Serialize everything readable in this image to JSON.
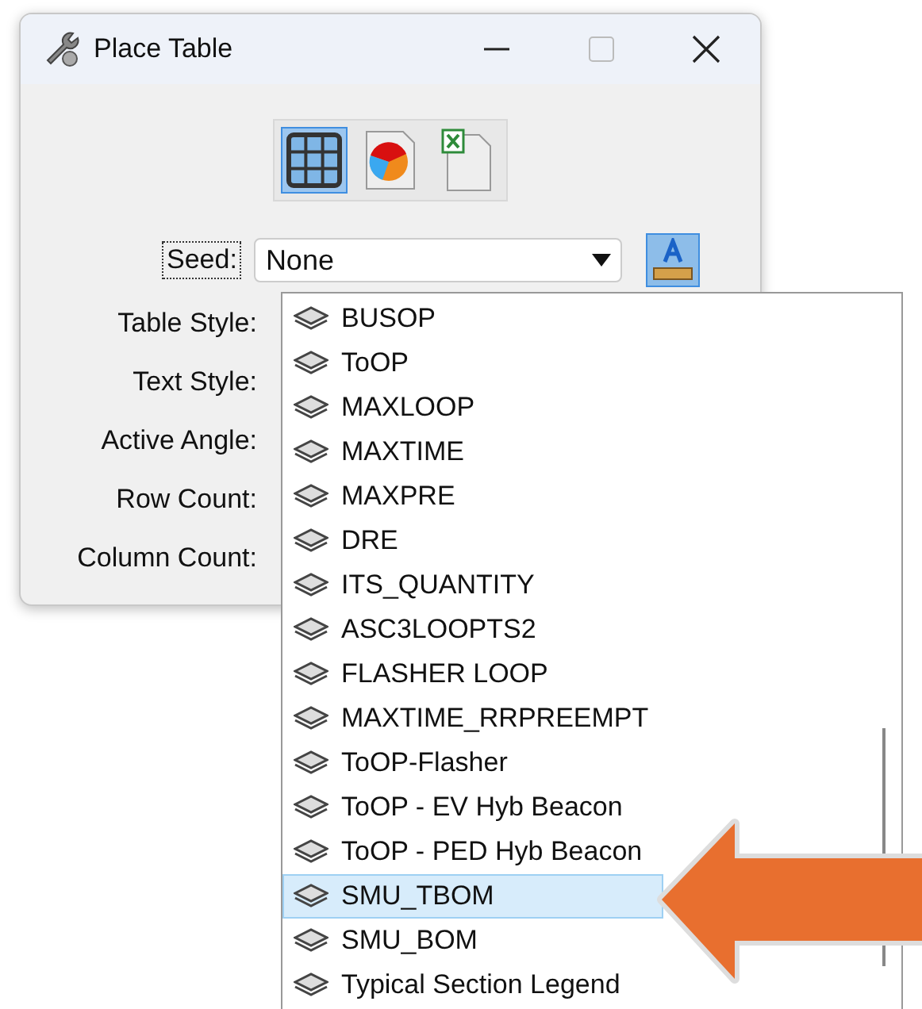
{
  "window": {
    "title": "Place Table"
  },
  "modes": [
    {
      "kind": "table",
      "selected": true
    },
    {
      "kind": "chart",
      "selected": false
    },
    {
      "kind": "spreadsheet",
      "selected": false
    }
  ],
  "seed": {
    "label": "Seed:",
    "value": "None"
  },
  "fields": [
    {
      "label": "Table Style:"
    },
    {
      "label": "Text Style:"
    },
    {
      "label": "Active Angle:"
    },
    {
      "label": "Row Count:"
    },
    {
      "label": "Column Count:"
    }
  ],
  "seed_list": [
    {
      "name": "BUSOP",
      "selected": false
    },
    {
      "name": "ToOP",
      "selected": false
    },
    {
      "name": "MAXLOOP",
      "selected": false
    },
    {
      "name": "MAXTIME",
      "selected": false
    },
    {
      "name": "MAXPRE",
      "selected": false
    },
    {
      "name": "DRE",
      "selected": false
    },
    {
      "name": "ITS_QUANTITY",
      "selected": false
    },
    {
      "name": "ASC3LOOPTS2",
      "selected": false
    },
    {
      "name": "FLASHER LOOP",
      "selected": false
    },
    {
      "name": "MAXTIME_RRPREEMPT",
      "selected": false
    },
    {
      "name": "ToOP-Flasher",
      "selected": false
    },
    {
      "name": "ToOP - EV Hyb Beacon",
      "selected": false
    },
    {
      "name": "ToOP - PED Hyb Beacon",
      "selected": false
    },
    {
      "name": "SMU_TBOM",
      "selected": true
    },
    {
      "name": "SMU_BOM",
      "selected": false
    },
    {
      "name": "Typical Section Legend",
      "selected": false
    }
  ]
}
